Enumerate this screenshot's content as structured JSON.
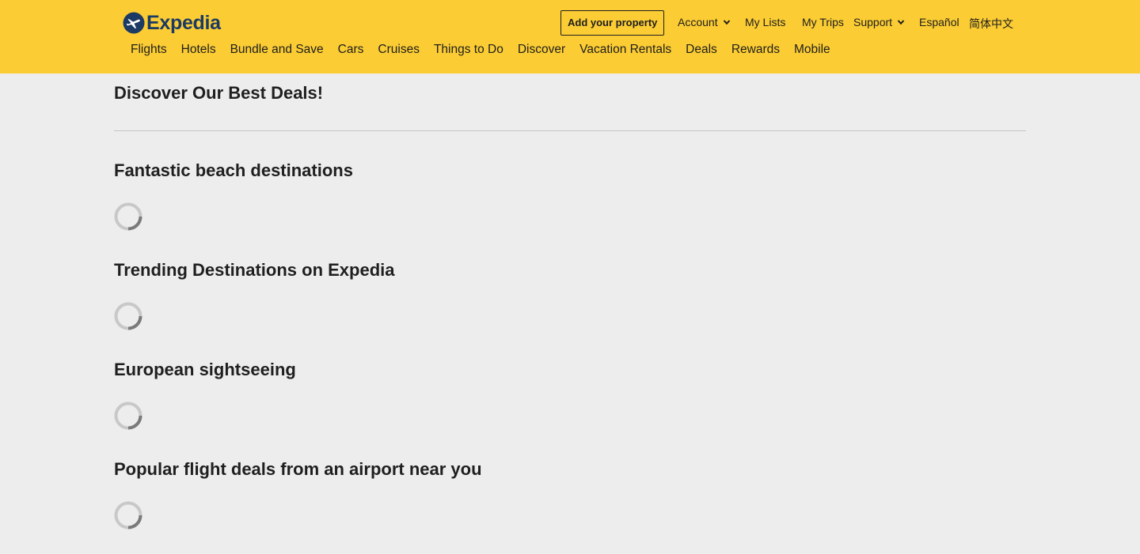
{
  "brand": {
    "name": "Expedia",
    "color": "#1b3a64",
    "header_bg": "#fbcc33",
    "page_bg": "#ededed"
  },
  "utility_nav": {
    "add_property": "Add your property",
    "account": "Account",
    "my_lists": "My Lists",
    "my_trips": "My Trips",
    "support": "Support",
    "language_es": "Español",
    "language_zh": "简体中文"
  },
  "main_nav": [
    {
      "label": "Flights"
    },
    {
      "label": "Hotels"
    },
    {
      "label": "Bundle and Save"
    },
    {
      "label": "Cars"
    },
    {
      "label": "Cruises"
    },
    {
      "label": "Things to Do"
    },
    {
      "label": "Discover"
    },
    {
      "label": "Vacation Rentals"
    },
    {
      "label": "Deals"
    },
    {
      "label": "Rewards"
    },
    {
      "label": "Mobile"
    }
  ],
  "page": {
    "title": "Discover Our Best Deals!"
  },
  "sections": [
    {
      "title": "Fantastic beach destinations",
      "state": "loading"
    },
    {
      "title": "Trending Destinations on Expedia",
      "state": "loading"
    },
    {
      "title": "European sightseeing",
      "state": "loading"
    },
    {
      "title": "Popular flight deals from an airport near you",
      "state": "loading"
    }
  ],
  "icons": {
    "logo": "plane-globe-icon",
    "dropdown": "chevron-down-icon",
    "loading": "loading-spinner-icon"
  }
}
